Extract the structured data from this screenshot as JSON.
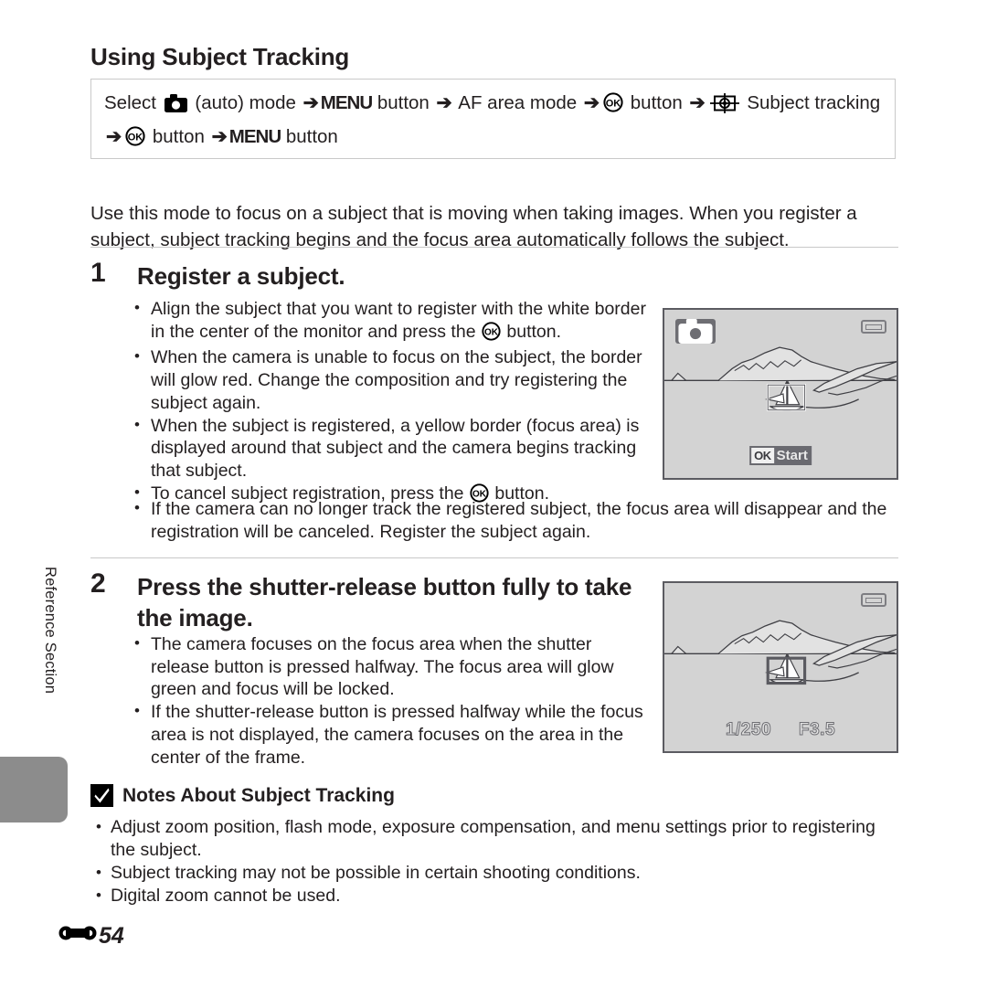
{
  "sidebar": {
    "label": "Reference Section"
  },
  "page": {
    "title": "Using Subject Tracking",
    "page_number": "54",
    "page_marker_icon": "reference-section-glyph"
  },
  "nav_path": {
    "segments": [
      {
        "type": "text",
        "value": "Select "
      },
      {
        "type": "icon",
        "value": "auto-camera-icon"
      },
      {
        "type": "text",
        "value": " (auto) mode "
      },
      {
        "type": "arrow",
        "value": "➔"
      },
      {
        "type": "menu",
        "value": "MENU"
      },
      {
        "type": "text",
        "value": " button "
      },
      {
        "type": "arrow",
        "value": "➔"
      },
      {
        "type": "text",
        "value": " AF area mode "
      },
      {
        "type": "arrow",
        "value": "➔"
      },
      {
        "type": "icon",
        "value": "ok-button-icon"
      },
      {
        "type": "text",
        "value": " button "
      },
      {
        "type": "arrow",
        "value": "➔"
      },
      {
        "type": "icon",
        "value": "subject-tracking-icon"
      },
      {
        "type": "text",
        "value": " Subject tracking "
      },
      {
        "type": "arrow",
        "value": "➔"
      },
      {
        "type": "icon",
        "value": "ok-button-icon"
      },
      {
        "type": "text",
        "value": " button "
      },
      {
        "type": "arrow",
        "value": "➔"
      },
      {
        "type": "menu",
        "value": "MENU"
      },
      {
        "type": "text",
        "value": " button"
      }
    ],
    "plain_text": "Select (auto) mode ➔ MENU button ➔ AF area mode ➔ OK button ➔ Subject tracking ➔ OK button ➔ MENU button"
  },
  "intro": "Use this mode to focus on a subject that is moving when taking images. When you register a subject, subject tracking begins and the focus area automatically follows the subject.",
  "steps": [
    {
      "number": "1",
      "heading": "Register a subject.",
      "bullets_narrow": [
        "Align the subject that you want to register with the white border in the center of the monitor and press the Ⓚ button.",
        "When the camera is unable to focus on the subject, the border will glow red. Change the composition and try registering the subject again.",
        "When the subject is registered, a yellow border (focus area) is displayed around that subject and the camera begins tracking that subject.",
        "To cancel subject registration, press the Ⓚ button."
      ],
      "bullets_wide": [
        "If the camera can no longer track the registered subject, the focus area will disappear and the registration will be canceled. Register the subject again."
      ]
    },
    {
      "number": "2",
      "heading": "Press the shutter-release button fully to take the image.",
      "bullets_narrow": [
        "The camera focuses on the focus area when the shutter release button is pressed halfway. The focus area will glow green and focus will be locked.",
        "If the shutter-release button is pressed halfway while the focus area is not displayed, the camera focuses on the area in the center of the frame."
      ],
      "bullets_wide": []
    }
  ],
  "notes": {
    "icon": "caution-check-icon",
    "heading": "Notes About Subject Tracking",
    "bullets": [
      "Adjust zoom position, flash mode, exposure compensation, and menu settings prior to registering the subject.",
      "Subject tracking may not be possible in certain shooting conditions.",
      "Digital zoom cannot be used."
    ]
  },
  "monitors": [
    {
      "name": "monitor-register-subject",
      "mode_icon": "auto-camera-icon",
      "battery_icon": "battery-icon",
      "status_ok_label": "OK",
      "status_label": "Start",
      "focus_border": "white",
      "scene": "seascape-with-sailboat"
    },
    {
      "name": "monitor-shutter-release",
      "battery_icon": "battery-icon",
      "shutter_speed": "1/250",
      "aperture": "F3.5",
      "focus_border": "dark",
      "scene": "seascape-with-sailboat"
    }
  ],
  "colors": {
    "text": "#231f20",
    "rule": "#c8c8c8",
    "box_border": "#c9c9c9",
    "tab_gray": "#8c8c8c",
    "monitor_bg": "#d3d3d3",
    "monitor_frame": "#5b5b61"
  }
}
